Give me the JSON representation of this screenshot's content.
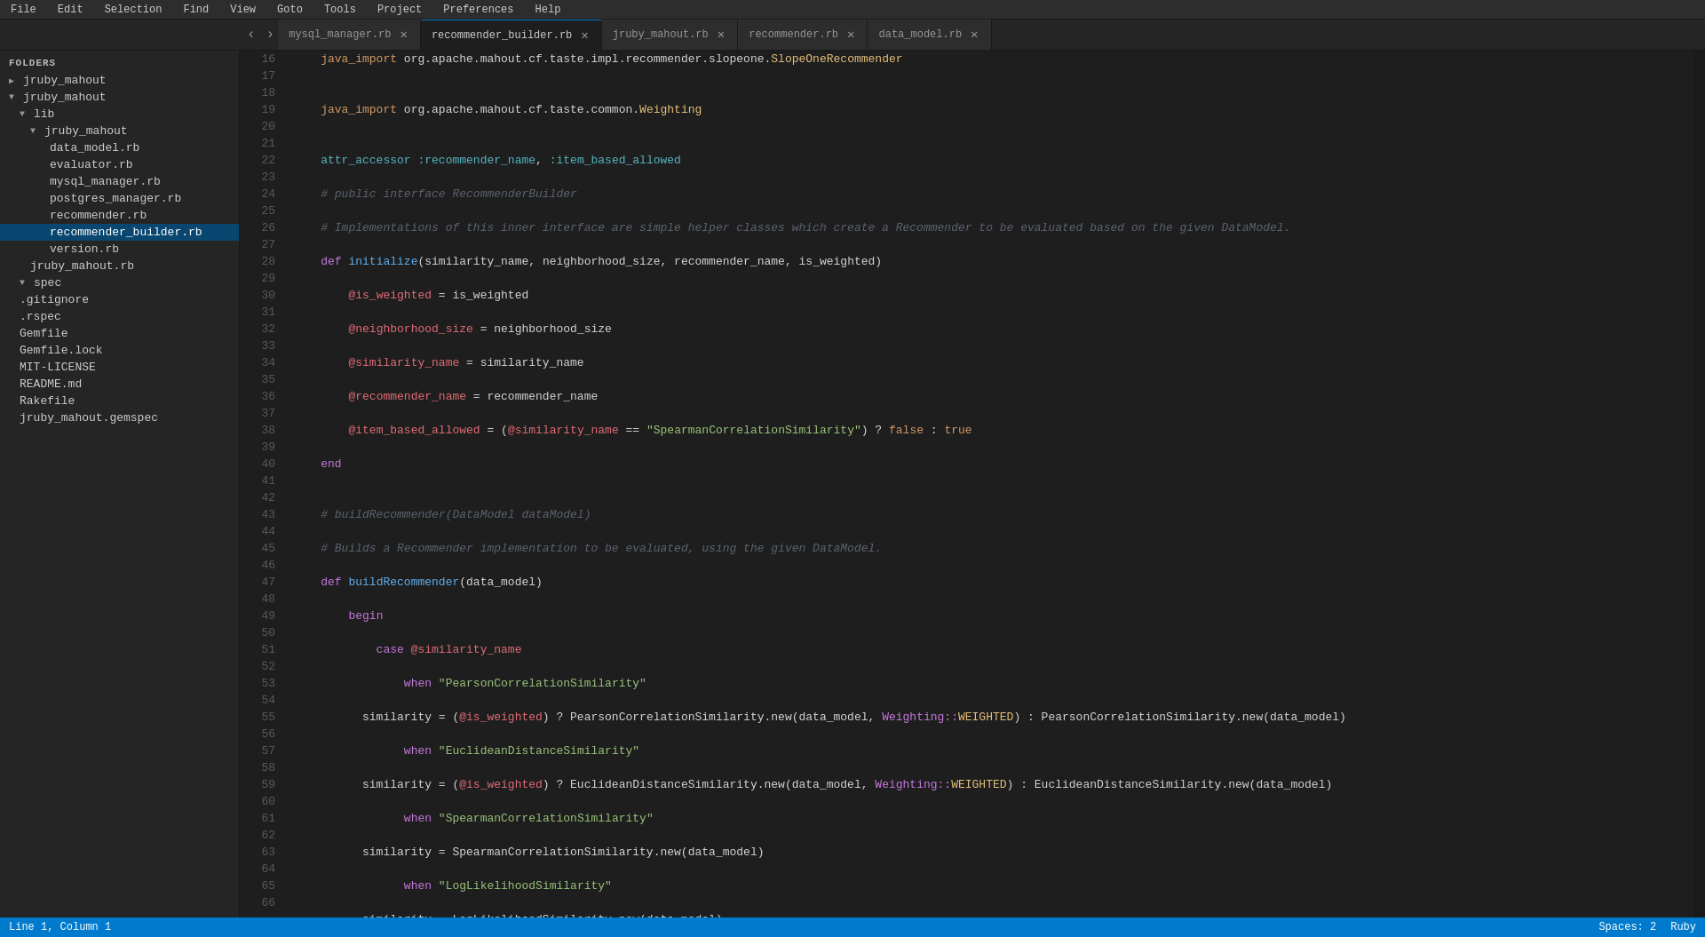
{
  "menu": {
    "items": [
      "File",
      "Edit",
      "Selection",
      "Find",
      "View",
      "Goto",
      "Tools",
      "Project",
      "Preferences",
      "Help"
    ]
  },
  "tabs": [
    {
      "id": "mysql_manager",
      "label": "mysql_manager.rb",
      "active": false,
      "modified": false
    },
    {
      "id": "recommender_builder",
      "label": "recommender_builder.rb",
      "active": true,
      "modified": false
    },
    {
      "id": "jruby_mahout",
      "label": "jruby_mahout.rb",
      "active": false,
      "modified": false
    },
    {
      "id": "recommender",
      "label": "recommender.rb",
      "active": false,
      "modified": false
    },
    {
      "id": "data_model",
      "label": "data_model.rb",
      "active": false,
      "modified": false
    }
  ],
  "sidebar": {
    "section_label": "FOLDERS",
    "root": "jruby_mahout",
    "items": [
      {
        "label": "jruby_mahout",
        "level": 0,
        "type": "folder",
        "expanded": true,
        "arrow": "▼"
      },
      {
        "label": "lib",
        "level": 1,
        "type": "folder",
        "expanded": true,
        "arrow": "▼"
      },
      {
        "label": "jruby_mahout",
        "level": 2,
        "type": "folder",
        "expanded": true,
        "arrow": "▼"
      },
      {
        "label": "data_model.rb",
        "level": 3,
        "type": "file",
        "arrow": ""
      },
      {
        "label": "evaluator.rb",
        "level": 3,
        "type": "file",
        "arrow": ""
      },
      {
        "label": "mysql_manager.rb",
        "level": 3,
        "type": "file",
        "arrow": ""
      },
      {
        "label": "postgres_manager.rb",
        "level": 3,
        "type": "file",
        "arrow": ""
      },
      {
        "label": "recommender.rb",
        "level": 3,
        "type": "file",
        "arrow": ""
      },
      {
        "label": "recommender_builder.rb",
        "level": 3,
        "type": "file",
        "arrow": "",
        "active": true
      },
      {
        "label": "version.rb",
        "level": 3,
        "type": "file",
        "arrow": ""
      },
      {
        "label": "jruby_mahout.rb",
        "level": 2,
        "type": "file",
        "arrow": ""
      },
      {
        "label": "spec",
        "level": 1,
        "type": "folder",
        "expanded": true,
        "arrow": "▼"
      },
      {
        "label": ".gitignore",
        "level": 1,
        "type": "file",
        "arrow": ""
      },
      {
        "label": ".rspec",
        "level": 1,
        "type": "file",
        "arrow": ""
      },
      {
        "label": "Gemfile",
        "level": 1,
        "type": "file",
        "arrow": ""
      },
      {
        "label": "Gemfile.lock",
        "level": 1,
        "type": "file",
        "arrow": ""
      },
      {
        "label": "MIT-LICENSE",
        "level": 1,
        "type": "file",
        "arrow": ""
      },
      {
        "label": "README.md",
        "level": 1,
        "type": "file",
        "arrow": ""
      },
      {
        "label": "Rakefile",
        "level": 1,
        "type": "file",
        "arrow": ""
      },
      {
        "label": "jruby_mahout.gemspec",
        "level": 1,
        "type": "file",
        "arrow": ""
      }
    ]
  },
  "status": {
    "position": "Line 1, Column 1",
    "spaces": "Spaces: 2",
    "language": "Ruby"
  }
}
